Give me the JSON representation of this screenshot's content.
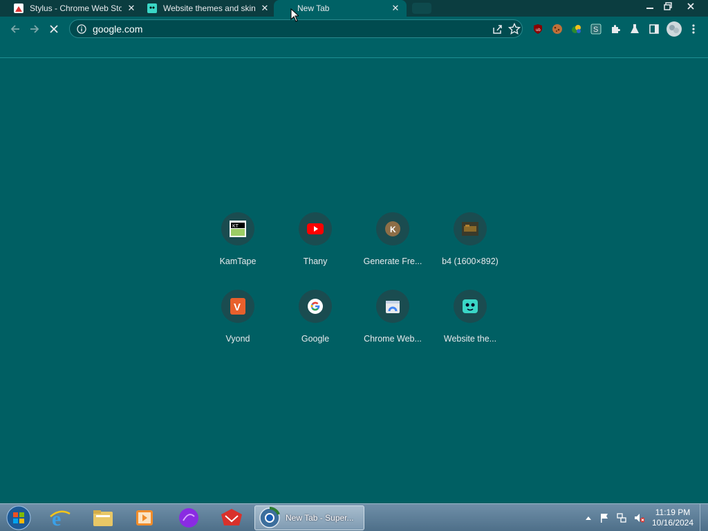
{
  "tabs": [
    {
      "title": "Stylus - Chrome Web Store",
      "favicon": "stylus-favicon",
      "active": false
    },
    {
      "title": "Website themes and skins",
      "favicon": "website-themes-favicon",
      "active": false
    },
    {
      "title": "New Tab",
      "favicon": "",
      "active": true
    }
  ],
  "omnibox": {
    "url": "google.com"
  },
  "shortcuts": [
    {
      "label": "KamTape",
      "icon": "kamtape-icon"
    },
    {
      "label": "Thany",
      "icon": "youtube-icon"
    },
    {
      "label": "Generate Fre...",
      "icon": "k-letter-icon",
      "letter": "K"
    },
    {
      "label": "b4 (1600×892)",
      "icon": "b4-image-icon"
    },
    {
      "label": "Vyond",
      "icon": "vyond-icon",
      "letter": "V"
    },
    {
      "label": "Google",
      "icon": "google-icon"
    },
    {
      "label": "Chrome Web...",
      "icon": "chrome-web-store-icon"
    },
    {
      "label": "Website the...",
      "icon": "website-themes-icon"
    }
  ],
  "extensions": [
    "ublock-icon",
    "cookie-icon",
    "colorful-ext-icon",
    "s-extension-icon",
    "extensions-puzzle-icon",
    "labs-flask-icon",
    "side-panel-icon",
    "profile-avatar",
    "chrome-menu-icon"
  ],
  "taskbar": {
    "active_task": "New Tab - Super...",
    "time": "11:19 PM",
    "date": "10/16/2024"
  },
  "colors": {
    "background": "#005f63",
    "tabstrip": "#0b3d40",
    "shortcut_circle": "#1a4c50"
  }
}
